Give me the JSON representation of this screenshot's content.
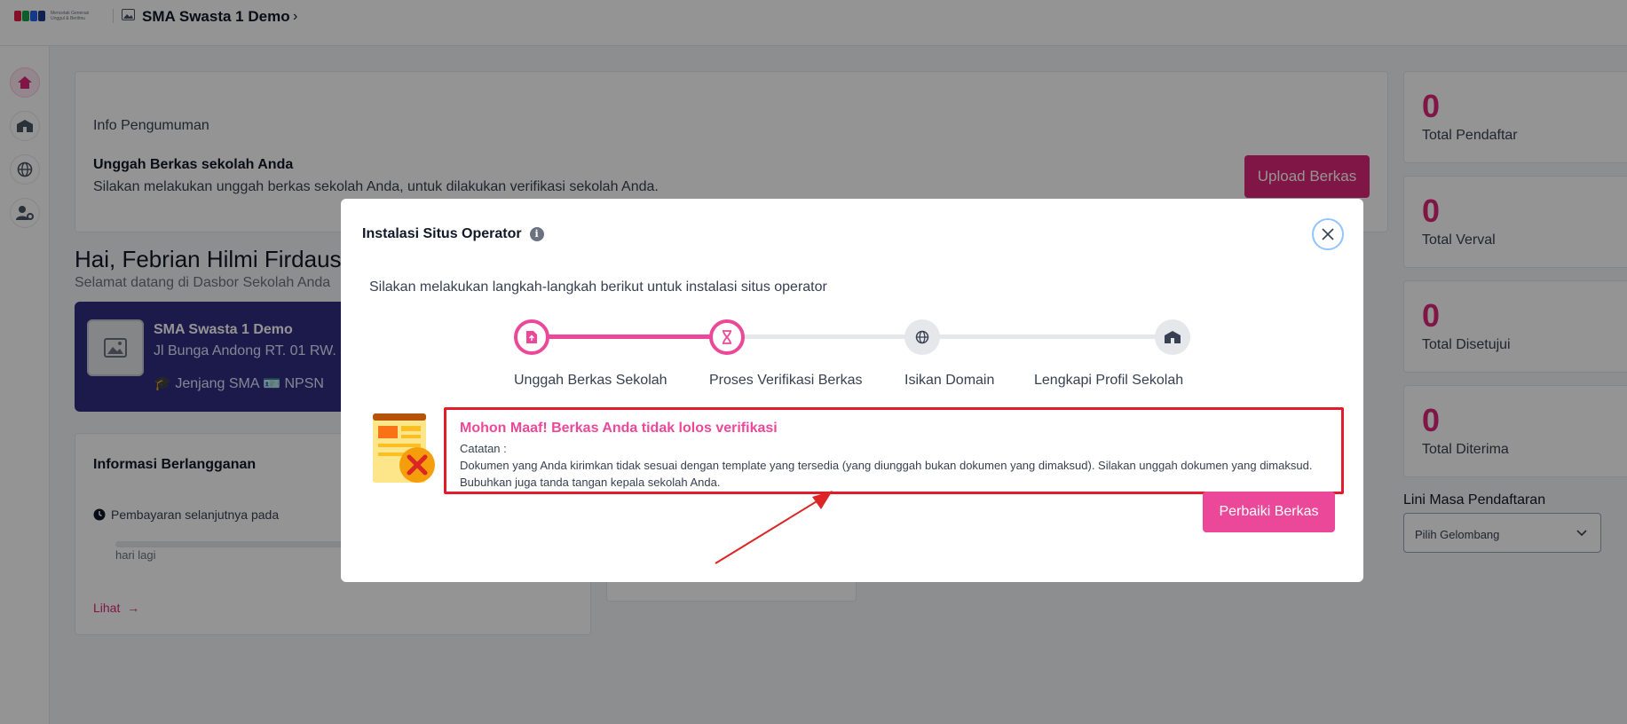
{
  "header": {
    "logo_text": "Mencetak Generasi Unggul & Berilmu",
    "school_name": "SMA Swasta 1 Demo"
  },
  "sidebar": {
    "items": [
      "home-icon",
      "school-icon",
      "globe-icon",
      "user-gear-icon"
    ]
  },
  "announcement": {
    "title": "Info Pengumuman",
    "heading": "Unggah Berkas sekolah Anda",
    "description": "Silakan melakukan unggah berkas sekolah Anda, untuk dilakukan verifikasi sekolah Anda.",
    "button_label": "Upload Berkas"
  },
  "greeting": {
    "hai": "Hai, Febrian Hilmi Firdaus",
    "welcome": "Selamat datang di Dasbor Sekolah Anda"
  },
  "school_card": {
    "name": "SMA Swasta 1 Demo",
    "address": "Jl Bunga Andong RT. 01 RW.",
    "jenjang": "Jenjang SMA",
    "npsn": "NPSN"
  },
  "subscription": {
    "title": "Informasi Berlangganan",
    "next_payment": "Pembayaran selanjutnya pada",
    "days": "hari lagi",
    "link": "Lihat"
  },
  "stats": [
    {
      "value": "0",
      "label": "Total Pendaftar"
    },
    {
      "value": "0",
      "label": "Total Verval"
    },
    {
      "value": "0",
      "label": "Total Disetujui"
    },
    {
      "value": "0",
      "label": "Total Diterima"
    }
  ],
  "timeline": {
    "title": "Lini Masa Pendaftaran",
    "select_value": "Pilih Gelombang"
  },
  "modal": {
    "title": "Instalasi Situs Operator",
    "description": "Silakan melakukan langkah-langkah berikut untuk instalasi situs operator",
    "steps": [
      {
        "label": "Unggah Berkas Sekolah",
        "status": "done"
      },
      {
        "label": "Proses Verifikasi Berkas",
        "status": "active"
      },
      {
        "label": "Isikan Domain",
        "status": "pending"
      },
      {
        "label": "Lengkapi Profil Sekolah",
        "status": "pending"
      }
    ],
    "error_title": "Mohon Maaf! Berkas Anda tidak lolos verifikasi",
    "note_label": "Catatan :",
    "note_text": "Dokumen yang Anda kirimkan tidak sesuai dengan template yang tersedia (yang diunggah bukan dokumen yang dimaksud). Silakan unggah dokumen yang dimaksud. Bubuhkan juga tanda tangan kepala sekolah Anda.",
    "fix_button": "Perbaiki Berkas"
  },
  "colors": {
    "accent": "#ec4899",
    "brand_dark": "#312e81",
    "highlight": "#e11d2b"
  }
}
